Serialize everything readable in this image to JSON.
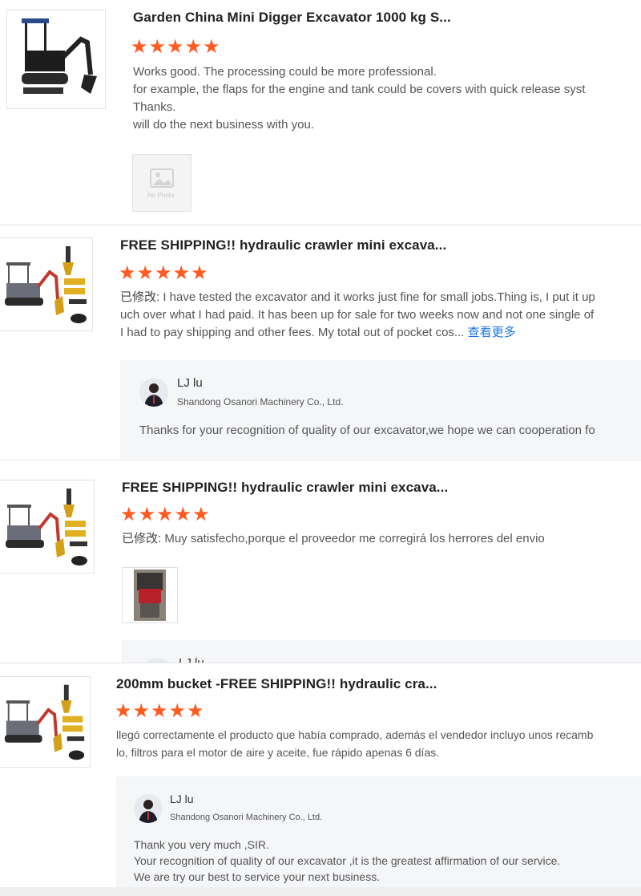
{
  "reviews": [
    {
      "title": "Garden China Mini Digger Excavator 1000 kg S...",
      "stars": "★★★★★",
      "lines": [
        "Works good. The processing could be more professional.",
        "for example, the flaps for the engine and tank could be covers with quick release syst",
        "Thanks.",
        "will do the next business with you."
      ],
      "photo_label": "No Photo"
    },
    {
      "title": "FREE SHIPPING!! hydraulic crawler mini excava...",
      "stars": "★★★★★",
      "modified": "已修改:",
      "lines": [
        " I have tested the excavator and it works just fine for small jobs.Thing is, I put it up",
        "uch over what I had paid.  It has been up for sale for two weeks now and not one single of",
        "I had to pay shipping and other fees.  My total out of pocket cos... "
      ],
      "more": "查看更多",
      "reply": {
        "name": "LJ lu",
        "company": "Shandong Osanori Machinery Co., Ltd.",
        "text": "Thanks for your recognition of quality of our excavator,we hope we can cooperation fo"
      }
    },
    {
      "title": "FREE SHIPPING!! hydraulic crawler mini excava...",
      "stars": "★★★★★",
      "modified": "已修改:",
      "lines": [
        " Muy satisfecho,porque el proveedor me corregirá los herrores del envio"
      ],
      "reply": {
        "name": "LJ lu"
      }
    },
    {
      "title": "200mm bucket -FREE SHIPPING!! hydraulic cra...",
      "stars": "★★★★★",
      "lines": [
        "llegó correctamente el producto que había comprado, además el vendedor incluyo unos recamb",
        "lo, filtros para el motor de aire y aceite, fue rápido apenas 6 días."
      ],
      "reply": {
        "name": "LJ lu",
        "company": "Shandong Osanori Machinery Co., Ltd.",
        "lines": [
          "Thank you very much ,SIR.",
          "Your recognition of quality of our excavator ,it is the greatest affirmation of our service.",
          "We are try our best to service your next business."
        ]
      }
    }
  ],
  "colors": {
    "star": "#ff5a1f",
    "link": "#1a73e8",
    "reply_bg": "#f5f6f8"
  },
  "icons": [
    "excavator-thumbnail",
    "no-photo-icon",
    "avatar-icon"
  ]
}
